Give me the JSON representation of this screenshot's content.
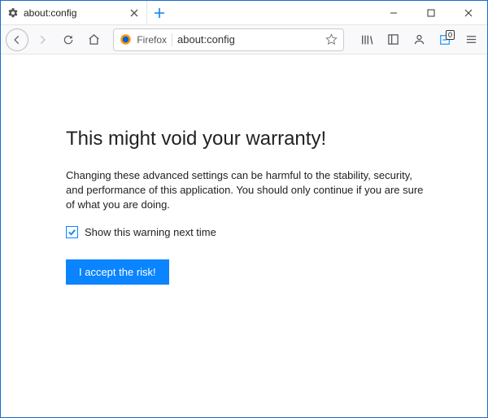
{
  "window": {
    "tab": {
      "title": "about:config"
    }
  },
  "url": {
    "identity_label": "Firefox",
    "value": "about:config"
  },
  "toolbar": {
    "badge_count": "0"
  },
  "warning": {
    "title": "This might void your warranty!",
    "body": "Changing these advanced settings can be harmful to the stability, security, and performance of this application. You should only continue if you are sure of what you are doing.",
    "checkbox_label": "Show this warning next time",
    "checkbox_checked": true,
    "accept_label": "I accept the risk!"
  }
}
